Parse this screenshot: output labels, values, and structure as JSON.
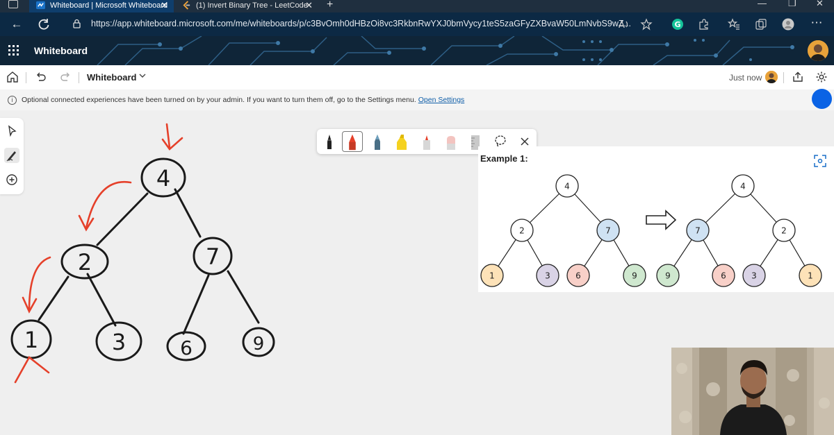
{
  "browser": {
    "tabs": [
      {
        "title": "Whiteboard | Microsoft Whiteboard",
        "active": true
      },
      {
        "title": "(1) Invert Binary Tree - LeetCode",
        "active": false
      }
    ],
    "new_tab_symbol": "+",
    "close_symbol": "✕",
    "url": "https://app.whiteboard.microsoft.com/me/whiteboards/p/c3BvOmh0dHBzOi8vc3RkbnRwYXJ0bmVycy1teS5zaGFyZXBvaW50LmNvbS9wZ..."
  },
  "app": {
    "name": "Whiteboard",
    "board_name": "Whiteboard",
    "save_status": "Just now"
  },
  "banner": {
    "text": "Optional connected experiences have been turned on by your admin. If you want to turn them off, go to the Settings menu.",
    "link": "Open Settings"
  },
  "example": {
    "title": "Example 1:",
    "input_tree": [
      {
        "label": "4",
        "fill": "#ffffff"
      },
      {
        "label": "2",
        "fill": "#ffffff"
      },
      {
        "label": "7",
        "fill": "#cfe2f3"
      },
      {
        "label": "1",
        "fill": "#fde2b8"
      },
      {
        "label": "3",
        "fill": "#d9d3e6"
      },
      {
        "label": "6",
        "fill": "#f8d0c8"
      },
      {
        "label": "9",
        "fill": "#cfe8cf"
      }
    ],
    "output_tree": [
      {
        "label": "4",
        "fill": "#ffffff"
      },
      {
        "label": "7",
        "fill": "#cfe2f3"
      },
      {
        "label": "2",
        "fill": "#ffffff"
      },
      {
        "label": "9",
        "fill": "#cfe8cf"
      },
      {
        "label": "6",
        "fill": "#f8d0c8"
      },
      {
        "label": "3",
        "fill": "#d9d3e6"
      },
      {
        "label": "1",
        "fill": "#fde2b8"
      }
    ]
  },
  "handwritten_tree": [
    "4",
    "2",
    "7",
    "1",
    "3",
    "6",
    "9"
  ],
  "colors": {
    "accent_blue": "#0b63e5",
    "ink_red": "#e5402a",
    "link": "#0f5ea8"
  }
}
